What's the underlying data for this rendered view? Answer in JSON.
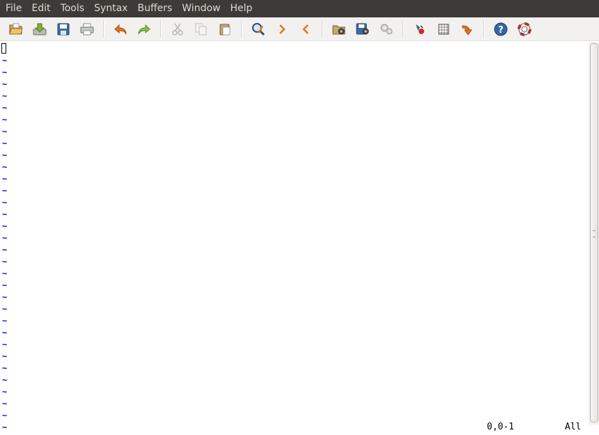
{
  "menu": {
    "items": [
      "File",
      "Edit",
      "Tools",
      "Syntax",
      "Buffers",
      "Window",
      "Help"
    ]
  },
  "toolbar": {
    "groups": [
      [
        "open-icon",
        "save-icon",
        "save-all-icon",
        "print-icon"
      ],
      [
        "undo-icon",
        "redo-icon"
      ],
      [
        "cut-icon",
        "copy-icon",
        "paste-icon"
      ],
      [
        "find-replace-icon",
        "find-next-icon",
        "find-prev-icon"
      ],
      [
        "load-session-icon",
        "save-session-icon",
        "run-script-icon"
      ],
      [
        "make-icon",
        "shell-icon",
        "jump-tag-icon"
      ],
      [
        "help-icon",
        "find-help-icon"
      ]
    ]
  },
  "editor": {
    "tilde_char": "~",
    "tilde_count": 32
  },
  "status": {
    "position": "0,0-1",
    "scroll": "All"
  },
  "colors": {
    "menubar_bg": "#3c3b37",
    "menubar_fg": "#dfdbd2",
    "toolbar_bg": "#f2f1f0",
    "tilde": "#0000ff",
    "accent_orange": "#e8721c",
    "accent_green": "#73a13a",
    "help_blue": "#3465a4"
  }
}
